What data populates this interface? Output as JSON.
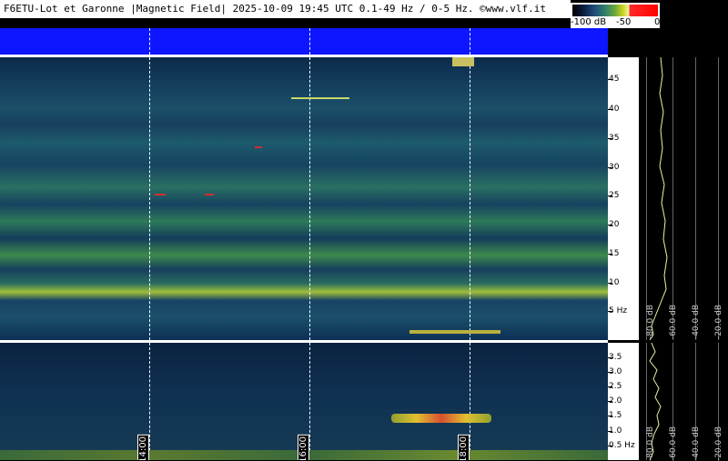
{
  "header": {
    "title": "F6ETU-Lot et Garonne |Magnetic Field| 2025-10-09 19:45 UTC 0.1-49 Hz / 0-5 Hz. ©www.vlf.it"
  },
  "colorbar": {
    "labels": [
      "-100 dB",
      "-50",
      "0"
    ]
  },
  "top_axis": {
    "labels": [
      "45",
      "40",
      "35",
      "30",
      "25",
      "20",
      "15",
      "10",
      "5 Hz"
    ]
  },
  "bottom_axis": {
    "labels": [
      "3.5",
      "3.0",
      "2.5",
      "2.0",
      "1.5",
      "1.0",
      "0.5 Hz"
    ]
  },
  "time_labels": [
    "14:00",
    "16:00",
    "18:00"
  ],
  "profile_db_labels": [
    "-80.0 dB",
    "-60.0 dB",
    "-40.0 dB",
    "-20.0 dB"
  ]
}
